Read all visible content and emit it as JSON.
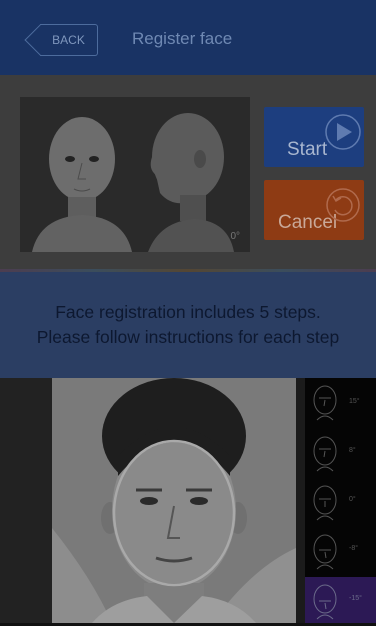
{
  "header": {
    "back_label": "BACK",
    "title": "Register face"
  },
  "preview": {
    "angle_label": "0°"
  },
  "buttons": {
    "start_label": "Start",
    "cancel_label": "Cancel"
  },
  "instruction": {
    "line1": "Face registration includes 5 steps.",
    "line2": "Please follow instructions for each step"
  },
  "pose_steps": [
    {
      "label": "15°"
    },
    {
      "label": "8°"
    },
    {
      "label": "0°"
    },
    {
      "label": "-8°"
    },
    {
      "label": "-15°",
      "active": true
    }
  ]
}
